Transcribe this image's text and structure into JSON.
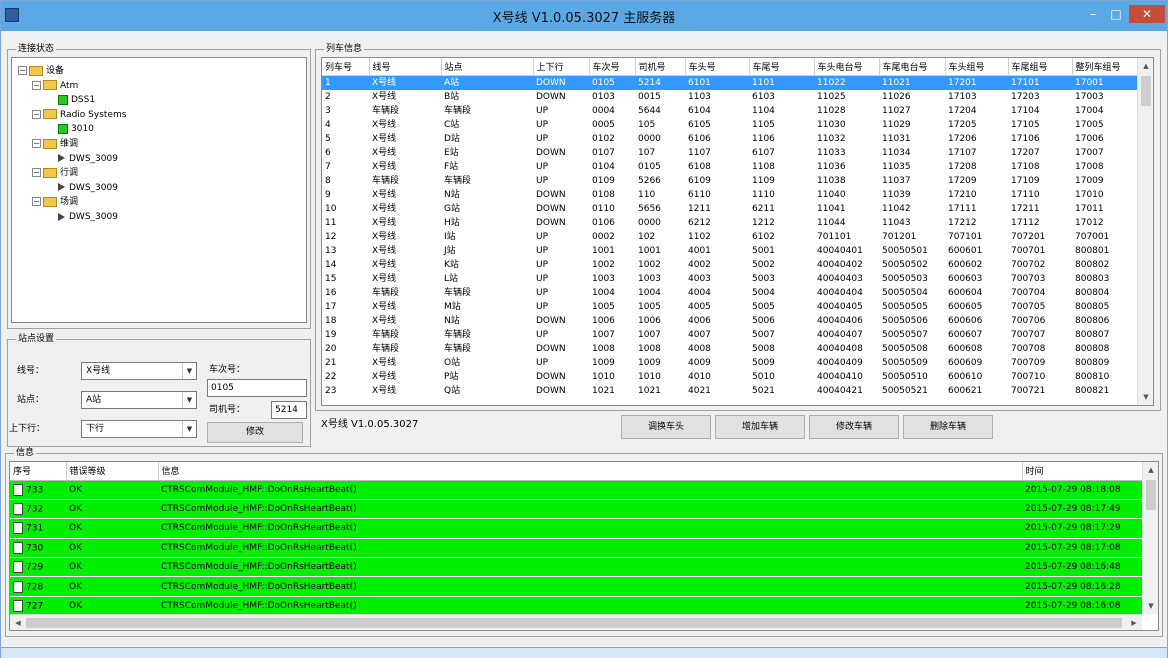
{
  "window": {
    "title": "X号线 V1.0.05.3027 主服务器"
  },
  "conn_panel": {
    "title": "连接状态",
    "tree": [
      {
        "label": "设备",
        "level": 0,
        "icon": "folder-icon"
      },
      {
        "label": "Atm",
        "level": 1,
        "icon": "folder-icon"
      },
      {
        "label": "DSS1",
        "level": 2,
        "icon": "green-status-icon"
      },
      {
        "label": "Radio Systems",
        "level": 1,
        "icon": "folder-icon"
      },
      {
        "label": "3010",
        "level": 2,
        "icon": "green-status-icon"
      },
      {
        "label": "维调",
        "level": 1,
        "icon": "folder-icon"
      },
      {
        "label": "DWS_3009",
        "level": 2,
        "icon": "play-icon"
      },
      {
        "label": "行调",
        "level": 1,
        "icon": "folder-icon"
      },
      {
        "label": "DWS_3009",
        "level": 2,
        "icon": "play-icon"
      },
      {
        "label": "场调",
        "level": 1,
        "icon": "folder-icon"
      },
      {
        "label": "DWS_3009",
        "level": 2,
        "icon": "play-icon"
      }
    ]
  },
  "station_panel": {
    "title": "站点设置",
    "line_label": "线号：",
    "line_value": "X号线",
    "station_label": "站点：",
    "station_value": "A站",
    "dir_label": "上下行：",
    "dir_value": "下行",
    "train_no_label": "车次号：",
    "train_no_value": "0105",
    "driver_label": "司机号：",
    "driver_value": "5214",
    "modify_button": "修改"
  },
  "train_panel": {
    "title": "列车信息",
    "columns": [
      "列车号",
      "线号",
      "站点",
      "上下行",
      "车次号",
      "司机号",
      "车头号",
      "车尾号",
      "车头电台号",
      "车尾电台号",
      "车头组号",
      "车尾组号",
      "整列车组号"
    ],
    "rows": [
      [
        "1",
        "X号线",
        "A站",
        "DOWN",
        "0105",
        "5214",
        "6101",
        "1101",
        "11022",
        "11021",
        "17201",
        "17101",
        "17001"
      ],
      [
        "2",
        "X号线",
        "B站",
        "DOWN",
        "0103",
        "0015",
        "1103",
        "6103",
        "11025",
        "11026",
        "17103",
        "17203",
        "17003"
      ],
      [
        "3",
        "车辆段",
        "车辆段",
        "UP",
        "0004",
        "5644",
        "6104",
        "1104",
        "11028",
        "11027",
        "17204",
        "17104",
        "17004"
      ],
      [
        "4",
        "X号线",
        "C站",
        "UP",
        "0005",
        "105",
        "6105",
        "1105",
        "11030",
        "11029",
        "17205",
        "17105",
        "17005"
      ],
      [
        "5",
        "X号线",
        "D站",
        "UP",
        "0102",
        "0000",
        "6106",
        "1106",
        "11032",
        "11031",
        "17206",
        "17106",
        "17006"
      ],
      [
        "6",
        "X号线",
        "E站",
        "DOWN",
        "0107",
        "107",
        "1107",
        "6107",
        "11033",
        "11034",
        "17107",
        "17207",
        "17007"
      ],
      [
        "7",
        "X号线",
        "F站",
        "UP",
        "0104",
        "0105",
        "6108",
        "1108",
        "11036",
        "11035",
        "17208",
        "17108",
        "17008"
      ],
      [
        "8",
        "车辆段",
        "车辆段",
        "UP",
        "0109",
        "5266",
        "6109",
        "1109",
        "11038",
        "11037",
        "17209",
        "17109",
        "17009"
      ],
      [
        "9",
        "X号线",
        "N站",
        "DOWN",
        "0108",
        "110",
        "6110",
        "1110",
        "11040",
        "11039",
        "17210",
        "17110",
        "17010"
      ],
      [
        "10",
        "X号线",
        "G站",
        "DOWN",
        "0110",
        "5656",
        "1211",
        "6211",
        "11041",
        "11042",
        "17111",
        "17211",
        "17011"
      ],
      [
        "11",
        "X号线",
        "H站",
        "DOWN",
        "0106",
        "0000",
        "6212",
        "1212",
        "11044",
        "11043",
        "17212",
        "17112",
        "17012"
      ],
      [
        "12",
        "X号线",
        "I站",
        "UP",
        "0002",
        "102",
        "1102",
        "6102",
        "701101",
        "701201",
        "707101",
        "707201",
        "707001"
      ],
      [
        "13",
        "X号线",
        "J站",
        "UP",
        "1001",
        "1001",
        "4001",
        "5001",
        "40040401",
        "50050501",
        "600601",
        "700701",
        "800801"
      ],
      [
        "14",
        "X号线",
        "K站",
        "UP",
        "1002",
        "1002",
        "4002",
        "5002",
        "40040402",
        "50050502",
        "600602",
        "700702",
        "800802"
      ],
      [
        "15",
        "X号线",
        "L站",
        "UP",
        "1003",
        "1003",
        "4003",
        "5003",
        "40040403",
        "50050503",
        "600603",
        "700703",
        "800803"
      ],
      [
        "16",
        "车辆段",
        "车辆段",
        "UP",
        "1004",
        "1004",
        "4004",
        "5004",
        "40040404",
        "50050504",
        "600604",
        "700704",
        "800804"
      ],
      [
        "17",
        "X号线",
        "M站",
        "UP",
        "1005",
        "1005",
        "4005",
        "5005",
        "40040405",
        "50050505",
        "600605",
        "700705",
        "800805"
      ],
      [
        "18",
        "X号线",
        "N站",
        "DOWN",
        "1006",
        "1006",
        "4006",
        "5006",
        "40040406",
        "50050506",
        "600606",
        "700706",
        "800806"
      ],
      [
        "19",
        "车辆段",
        "车辆段",
        "UP",
        "1007",
        "1007",
        "4007",
        "5007",
        "40040407",
        "50050507",
        "600607",
        "700707",
        "800807"
      ],
      [
        "20",
        "车辆段",
        "车辆段",
        "DOWN",
        "1008",
        "1008",
        "4008",
        "5008",
        "40040408",
        "50050508",
        "600608",
        "700708",
        "800808"
      ],
      [
        "21",
        "X号线",
        "O站",
        "UP",
        "1009",
        "1009",
        "4009",
        "5009",
        "40040409",
        "50050509",
        "600609",
        "700709",
        "800809"
      ],
      [
        "22",
        "X号线",
        "P站",
        "DOWN",
        "1010",
        "1010",
        "4010",
        "5010",
        "40040410",
        "50050510",
        "600610",
        "700710",
        "800810"
      ],
      [
        "23",
        "X号线",
        "Q站",
        "DOWN",
        "1021",
        "1021",
        "4021",
        "5021",
        "40040421",
        "50050521",
        "600621",
        "700721",
        "800821"
      ]
    ],
    "selected_row": 0
  },
  "status": {
    "version": "X号线 V1.0.05.3027"
  },
  "actions": {
    "change_head": "调换车头",
    "add": "增加车辆",
    "modify": "修改车辆",
    "delete": "删除车辆"
  },
  "log_panel": {
    "title": "信息",
    "columns": [
      "序号",
      "错误等级",
      "信息",
      "时间"
    ],
    "rows": [
      [
        "733",
        "OK",
        "CTRSComModule_HMF::DoOnRsHeartBeat()",
        "2015-07-29 08:18:08"
      ],
      [
        "732",
        "OK",
        "CTRSComModule_HMF::DoOnRsHeartBeat()",
        "2015-07-29 08:17:49"
      ],
      [
        "731",
        "OK",
        "CTRSComModule_HMF::DoOnRsHeartBeat()",
        "2015-07-29 08:17:29"
      ],
      [
        "730",
        "OK",
        "CTRSComModule_HMF::DoOnRsHeartBeat()",
        "2015-07-29 08:17:08"
      ],
      [
        "729",
        "OK",
        "CTRSComModule_HMF::DoOnRsHeartBeat()",
        "2015-07-29 08:16:48"
      ],
      [
        "728",
        "OK",
        "CTRSComModule_HMF::DoOnRsHeartBeat()",
        "2015-07-29 08:16:28"
      ],
      [
        "727",
        "OK",
        "CTRSComModule_HMF::DoOnRsHeartBeat()",
        "2015-07-29 08:16:08"
      ]
    ],
    "row_color": "#00ee00"
  },
  "colors": {
    "titlebar": "#5aa9e6",
    "selection": "#3399ff",
    "close": "#c74c3c"
  }
}
